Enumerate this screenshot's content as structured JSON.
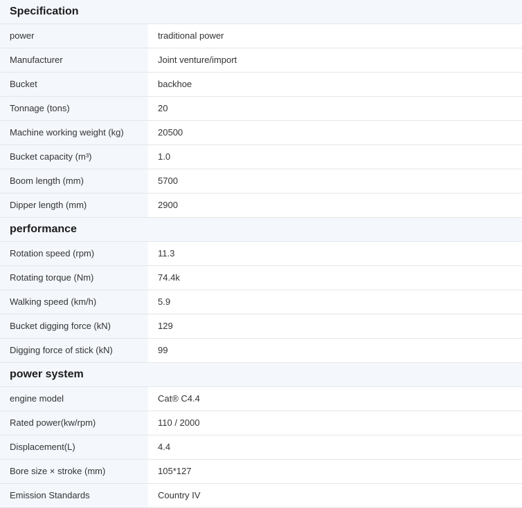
{
  "sections": [
    {
      "title": "Specification",
      "rows": [
        {
          "label": "power",
          "value": "traditional power"
        },
        {
          "label": "Manufacturer",
          "value": "Joint venture/import"
        },
        {
          "label": "Bucket",
          "value": "backhoe"
        },
        {
          "label": "Tonnage (tons)",
          "value": "20"
        },
        {
          "label": "Machine working weight (kg)",
          "value": "20500"
        },
        {
          "label": "Bucket capacity (m³)",
          "value": "1.0"
        },
        {
          "label": "Boom length (mm)",
          "value": "5700"
        },
        {
          "label": "Dipper length (mm)",
          "value": "2900"
        }
      ]
    },
    {
      "title": "performance",
      "rows": [
        {
          "label": "Rotation speed (rpm)",
          "value": "11.3"
        },
        {
          "label": "Rotating torque (Nm)",
          "value": "74.4k"
        },
        {
          "label": "Walking speed (km/h)",
          "value": "5.9"
        },
        {
          "label": "Bucket digging force (kN)",
          "value": "129"
        },
        {
          "label": "Digging force of stick (kN)",
          "value": "99"
        }
      ]
    },
    {
      "title": "power system",
      "rows": [
        {
          "label": "engine model",
          "value": "Cat® C4.4"
        },
        {
          "label": "Rated power(kw/rpm)",
          "value": "110 / 2000"
        },
        {
          "label": "Displacement(L)",
          "value": "4.4"
        },
        {
          "label": "Bore size × stroke (mm)",
          "value": "105*127"
        },
        {
          "label": "Emission Standards",
          "value": "Country IV"
        }
      ]
    }
  ]
}
